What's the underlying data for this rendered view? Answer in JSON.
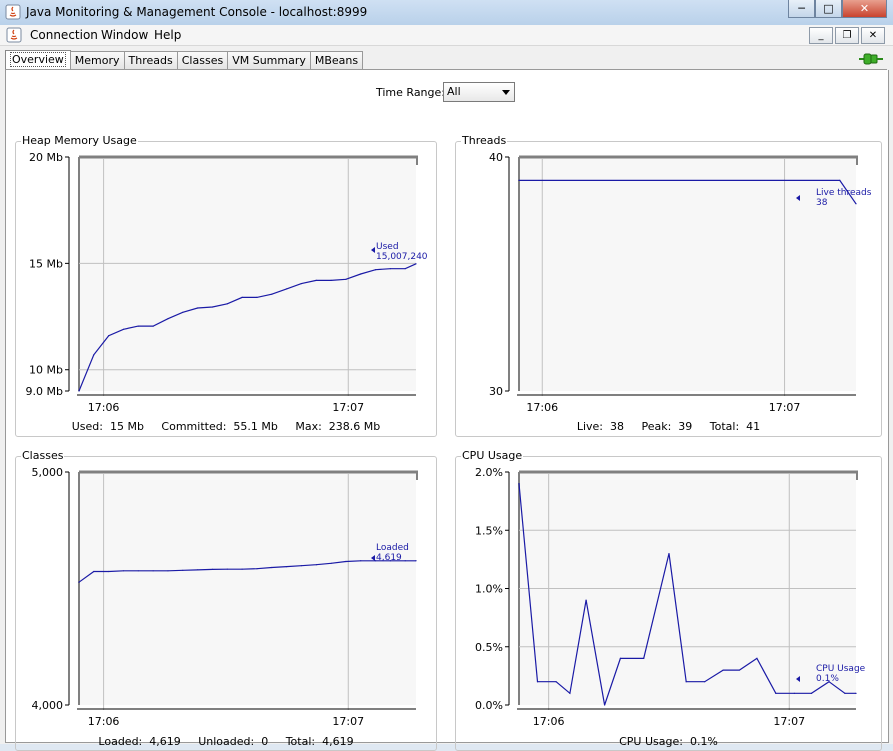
{
  "window": {
    "title": "Java Monitoring & Management Console - localhost:8999"
  },
  "menu": {
    "items": [
      "Connection",
      "Window",
      "Help"
    ]
  },
  "tabs": [
    "Overview",
    "Memory",
    "Threads",
    "Classes",
    "VM Summary",
    "MBeans"
  ],
  "active_tab": "Overview",
  "time_range": {
    "label": "Time Range:",
    "value": "All"
  },
  "colors": {
    "series": "#1a1aa6",
    "grid": "#c0c0c0",
    "plot_bg": "#f7f7f7",
    "plot_border": "#808080"
  },
  "icons": [
    "java-icon",
    "minimize-icon",
    "restore-icon",
    "close-icon",
    "connection-plug-icon",
    "dropdown-arrow-icon"
  ],
  "panels": {
    "heap": {
      "title": "Heap Memory Usage",
      "stats": "Used:  15 Mb     Committed:  55.1 Mb     Max:  238.6 Mb",
      "legend_name": "Used",
      "legend_value": "15,007,240"
    },
    "threads": {
      "title": "Threads",
      "stats": "Live:  38     Peak:  39     Total:  41",
      "legend_name": "Live threads",
      "legend_value": "38"
    },
    "classes": {
      "title": "Classes",
      "stats": "Loaded:  4,619     Unloaded:  0     Total:  4,619",
      "legend_name": "Loaded",
      "legend_value": "4,619"
    },
    "cpu": {
      "title": "CPU Usage",
      "stats": "CPU Usage:  0.1%",
      "legend_name": "CPU Usage",
      "legend_value": "0.1%"
    }
  },
  "chart_data": [
    {
      "type": "line",
      "title": "Heap Memory Usage",
      "x_ticks": [
        "17:06",
        "17:07"
      ],
      "x_tick_positions": [
        0.073,
        0.799
      ],
      "y_ticks": [
        "20 Mb",
        "15 Mb",
        "10 Mb",
        "9.0 Mb"
      ],
      "y_tick_values": [
        20,
        15,
        10,
        9
      ],
      "ylim": [
        9,
        20
      ],
      "xlim": [
        0,
        1
      ],
      "series": [
        {
          "name": "Used",
          "x": [
            0,
            0.044,
            0.088,
            0.132,
            0.176,
            0.22,
            0.264,
            0.308,
            0.352,
            0.396,
            0.44,
            0.484,
            0.528,
            0.572,
            0.616,
            0.66,
            0.704,
            0.748,
            0.792,
            0.836,
            0.88,
            0.924,
            0.968,
            1.0
          ],
          "values": [
            9.0,
            10.7,
            11.6,
            11.9,
            12.05,
            12.05,
            12.4,
            12.7,
            12.9,
            12.95,
            13.1,
            13.4,
            13.4,
            13.55,
            13.8,
            14.05,
            14.2,
            14.2,
            14.25,
            14.5,
            14.7,
            14.75,
            14.75,
            14.98
          ]
        }
      ]
    },
    {
      "type": "line",
      "title": "Threads",
      "x_ticks": [
        "17:06",
        "17:07"
      ],
      "x_tick_positions": [
        0.069,
        0.788
      ],
      "y_ticks": [
        "40",
        "30"
      ],
      "y_tick_values": [
        40,
        30
      ],
      "ylim": [
        30,
        40
      ],
      "xlim": [
        0,
        1
      ],
      "series": [
        {
          "name": "Live threads",
          "x": [
            0,
            0.952,
            1.0
          ],
          "values": [
            39,
            39,
            38
          ]
        }
      ]
    },
    {
      "type": "line",
      "title": "Classes",
      "x_ticks": [
        "17:06",
        "17:07"
      ],
      "x_tick_positions": [
        0.073,
        0.799
      ],
      "y_ticks": [
        "5,000",
        "4,000"
      ],
      "y_tick_values": [
        5000,
        4000
      ],
      "ylim": [
        4000,
        5000
      ],
      "xlim": [
        0,
        1
      ],
      "series": [
        {
          "name": "Loaded",
          "x": [
            0,
            0.044,
            0.088,
            0.132,
            0.176,
            0.22,
            0.264,
            0.308,
            0.352,
            0.396,
            0.44,
            0.484,
            0.528,
            0.572,
            0.616,
            0.66,
            0.704,
            0.748,
            0.792,
            0.836,
            0.88,
            0.924,
            0.968,
            1.0
          ],
          "values": [
            4527,
            4573,
            4573,
            4576,
            4576,
            4576,
            4576,
            4578,
            4580,
            4582,
            4583,
            4583,
            4585,
            4590,
            4594,
            4598,
            4602,
            4608,
            4616,
            4619,
            4619,
            4619,
            4619,
            4619
          ]
        }
      ]
    },
    {
      "type": "line",
      "title": "CPU Usage",
      "x_ticks": [
        "17:06",
        "17:07"
      ],
      "x_tick_positions": [
        0.088,
        0.802
      ],
      "y_ticks": [
        "2.0%",
        "1.5%",
        "1.0%",
        "0.5%",
        "0.0%"
      ],
      "y_tick_values": [
        2.0,
        1.5,
        1.0,
        0.5,
        0.0
      ],
      "ylim": [
        0,
        2.0
      ],
      "xlim": [
        0,
        1
      ],
      "series": [
        {
          "name": "CPU Usage",
          "x": [
            0,
            0.055,
            0.11,
            0.151,
            0.199,
            0.254,
            0.301,
            0.37,
            0.445,
            0.496,
            0.551,
            0.606,
            0.654,
            0.706,
            0.762,
            0.817,
            0.868,
            0.92,
            0.967,
            1.0
          ],
          "values": [
            1.9,
            0.2,
            0.2,
            0.1,
            0.9,
            0.0,
            0.4,
            0.4,
            1.3,
            0.2,
            0.2,
            0.3,
            0.3,
            0.4,
            0.1,
            0.1,
            0.1,
            0.2,
            0.1,
            0.1
          ]
        }
      ]
    }
  ]
}
